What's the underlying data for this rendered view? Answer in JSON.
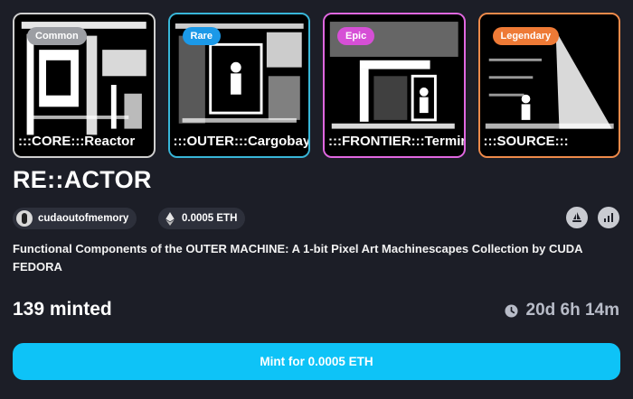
{
  "cards": [
    {
      "rarity": "Common",
      "title": ":::CORE:::Reactor"
    },
    {
      "rarity": "Rare",
      "title": ":::OUTER:::Cargobay"
    },
    {
      "rarity": "Epic",
      "title": ":::FRONTIER:::Terminal"
    },
    {
      "rarity": "Legendary",
      "title": ":::SOURCE:::"
    }
  ],
  "collection": {
    "title": "RE::ACTOR",
    "creator": "cudaoutofmemory",
    "price": "0.0005 ETH",
    "description": "Functional Components of the OUTER MACHINE: A 1-bit Pixel Art Machinescapes Collection by CUDA FEDORA",
    "minted": "139 minted",
    "time_left": "20d 6h 14m"
  },
  "mint_button": {
    "label": "Mint for 0.0005 ETH"
  },
  "colors": {
    "background": "#1c1e27",
    "accent": "#0ec3f7",
    "common": "#9c9ea3",
    "rare": "#1b99e8",
    "epic": "#d64fd6",
    "legendary": "#ee7a36"
  },
  "icons": [
    "ethereum-icon",
    "opensea-icon",
    "chart-icon",
    "clock-icon"
  ]
}
